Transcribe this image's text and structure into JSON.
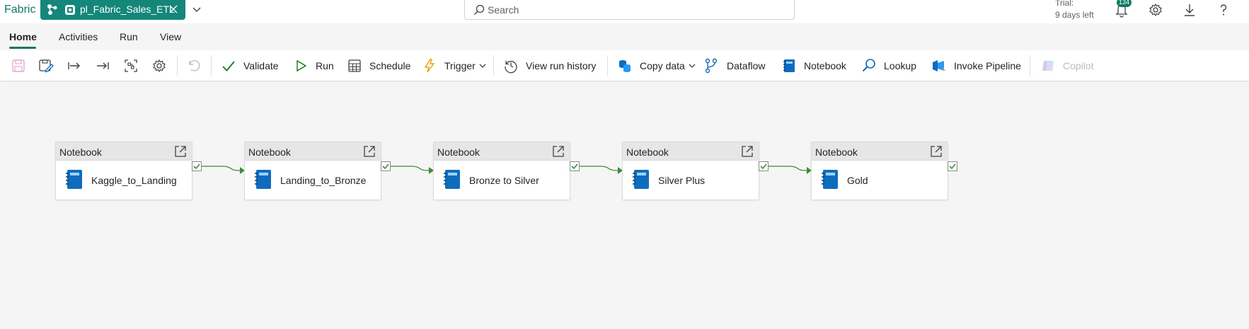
{
  "app": {
    "brand": "Fabric"
  },
  "item_tab": {
    "name": "pl_Fabric_Sales_ETL"
  },
  "search": {
    "placeholder": "Search"
  },
  "trial": {
    "line1": "Trial:",
    "line2": "9 days left"
  },
  "notifications": {
    "count": "134"
  },
  "menu": {
    "tabs": [
      "Home",
      "Activities",
      "Run",
      "View"
    ],
    "active": "Home"
  },
  "ribbon": {
    "validate": "Validate",
    "run": "Run",
    "schedule": "Schedule",
    "trigger": "Trigger",
    "view_run_history": "View run history",
    "copy_data": "Copy data",
    "dataflow": "Dataflow",
    "notebook": "Notebook",
    "lookup": "Lookup",
    "invoke_pipeline": "Invoke Pipeline",
    "copilot": "Copilot"
  },
  "pipeline": {
    "activities": [
      {
        "type": "Notebook",
        "name": "Kaggle_to_Landing"
      },
      {
        "type": "Notebook",
        "name": "Landing_to_Bronze"
      },
      {
        "type": "Notebook",
        "name": "Bronze to Silver"
      },
      {
        "type": "Notebook",
        "name": "Silver Plus"
      },
      {
        "type": "Notebook",
        "name": "Gold"
      }
    ],
    "connection": "on-success"
  },
  "colors": {
    "brand": "#117865",
    "tab_bg": "#14877a",
    "success": "#3b8c3b",
    "notebook_icon": "#0f6cbd"
  },
  "icons": {
    "toolbar": [
      "save-icon",
      "save-as-icon",
      "tab-right-icon",
      "tab-end-icon",
      "fit-view-icon",
      "settings-icon",
      "undo-icon"
    ]
  }
}
